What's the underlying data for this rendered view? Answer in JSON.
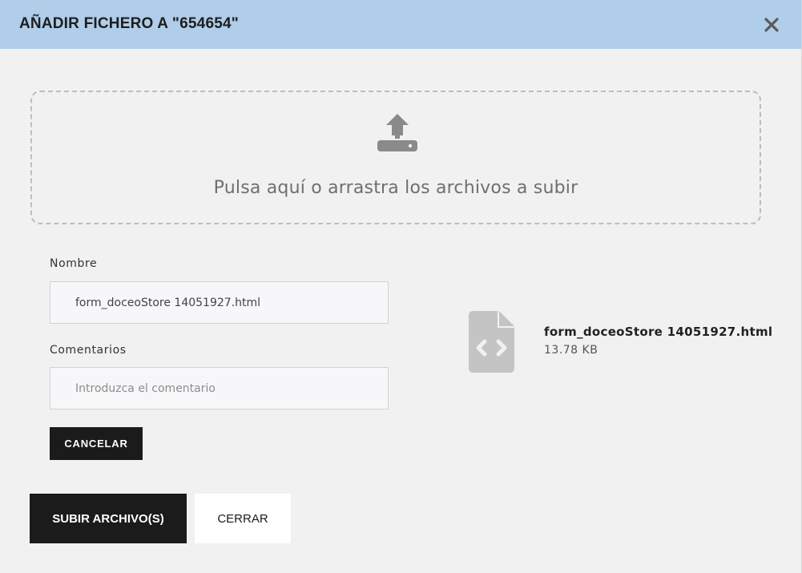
{
  "dialog": {
    "title": "AÑADIR FICHERO A \"654654\"",
    "close_icon": "close-icon"
  },
  "dropzone": {
    "icon": "upload-icon",
    "text": "Pulsa aquí o arrastra los archivos a subir"
  },
  "form": {
    "name_label": "Nombre",
    "name_value": "form_doceoStore 14051927.html",
    "comments_label": "Comentarios",
    "comments_value": "",
    "comments_placeholder": "Introduzca el comentario",
    "cancel_label": "CANCELAR"
  },
  "file": {
    "icon": "code-file-icon",
    "name": "form_doceoStore 14051927.html",
    "size": "13.78 KB"
  },
  "footer": {
    "upload_label": "SUBIR ARCHIVO(S)",
    "close_label": "CERRAR"
  },
  "colors": {
    "header_bg": "#b0cde9",
    "modal_bg": "#f1f1f1",
    "button_dark": "#1b1b1b",
    "icon_gray": "#8a8a8a",
    "file_icon_gray": "#c4c4c4"
  }
}
